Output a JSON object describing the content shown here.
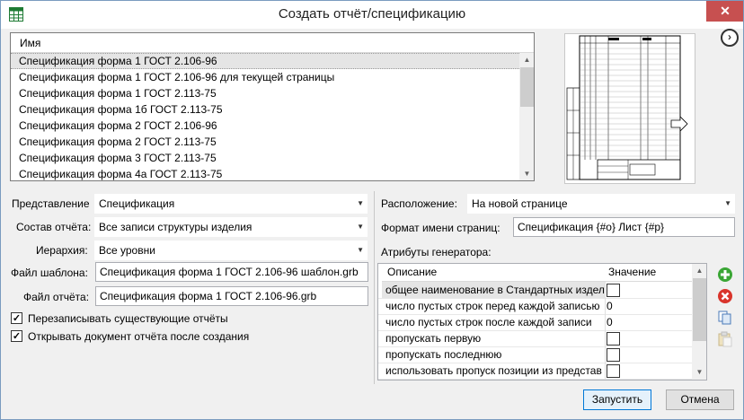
{
  "window": {
    "title": "Создать отчёт/спецификацию",
    "close_label": "✕"
  },
  "templates": {
    "header": "Имя",
    "items": [
      "Спецификация форма 1 ГОСТ 2.106-96",
      "Спецификация форма 1 ГОСТ 2.106-96 для текущей страницы",
      "Спецификация форма 1 ГОСТ 2.113-75",
      "Спецификация форма 1б ГОСТ 2.113-75",
      "Спецификация форма 2 ГОСТ 2.106-96",
      "Спецификация форма 2 ГОСТ 2.113-75",
      "Спецификация форма 3 ГОСТ 2.113-75",
      "Спецификация форма 4а ГОСТ 2.113-75"
    ],
    "selected_index": 0
  },
  "preview": {
    "nav_label": "›"
  },
  "form": {
    "representation_label": "Представление",
    "representation_value": "Спецификация",
    "composition_label": "Состав отчёта:",
    "composition_value": "Все записи структуры изделия",
    "hierarchy_label": "Иерархия:",
    "hierarchy_value": "Все уровни",
    "template_file_label": "Файл шаблона:",
    "template_file_value": "Спецификация форма 1 ГОСТ 2.106-96 шаблон.grb",
    "report_file_label": "Файл отчёта:",
    "report_file_value": "Спецификация форма 1 ГОСТ 2.106-96.grb",
    "overwrite_label": "Перезаписывать существующие отчёты",
    "overwrite_checked": true,
    "open_after_label": "Открывать документ отчёта после создания",
    "open_after_checked": true
  },
  "right": {
    "placement_label": "Расположение:",
    "placement_value": "На новой странице",
    "page_name_label": "Формат имени страниц:",
    "page_name_value": "Спецификация {#o} Лист {#p}",
    "generator_label": "Атрибуты генератора:",
    "grid": {
      "col_desc": "Описание",
      "col_value": "Значение",
      "rows": [
        {
          "desc": "общее наименование в Стандартных издел",
          "type": "check",
          "value": ""
        },
        {
          "desc": "число пустых строк перед каждой записью",
          "type": "text",
          "value": "0"
        },
        {
          "desc": "число пустых строк после каждой записи",
          "type": "text",
          "value": "0"
        },
        {
          "desc": "пропускать первую",
          "type": "check",
          "value": ""
        },
        {
          "desc": "пропускать последнюю",
          "type": "check",
          "value": ""
        },
        {
          "desc": "использовать пропуск позиции из представ",
          "type": "check",
          "value": ""
        }
      ]
    }
  },
  "buttons": {
    "run": "Запустить",
    "cancel": "Отмена"
  },
  "colors": {
    "add": "#3aa635",
    "remove": "#d9342b",
    "accent": "#0078d7"
  }
}
